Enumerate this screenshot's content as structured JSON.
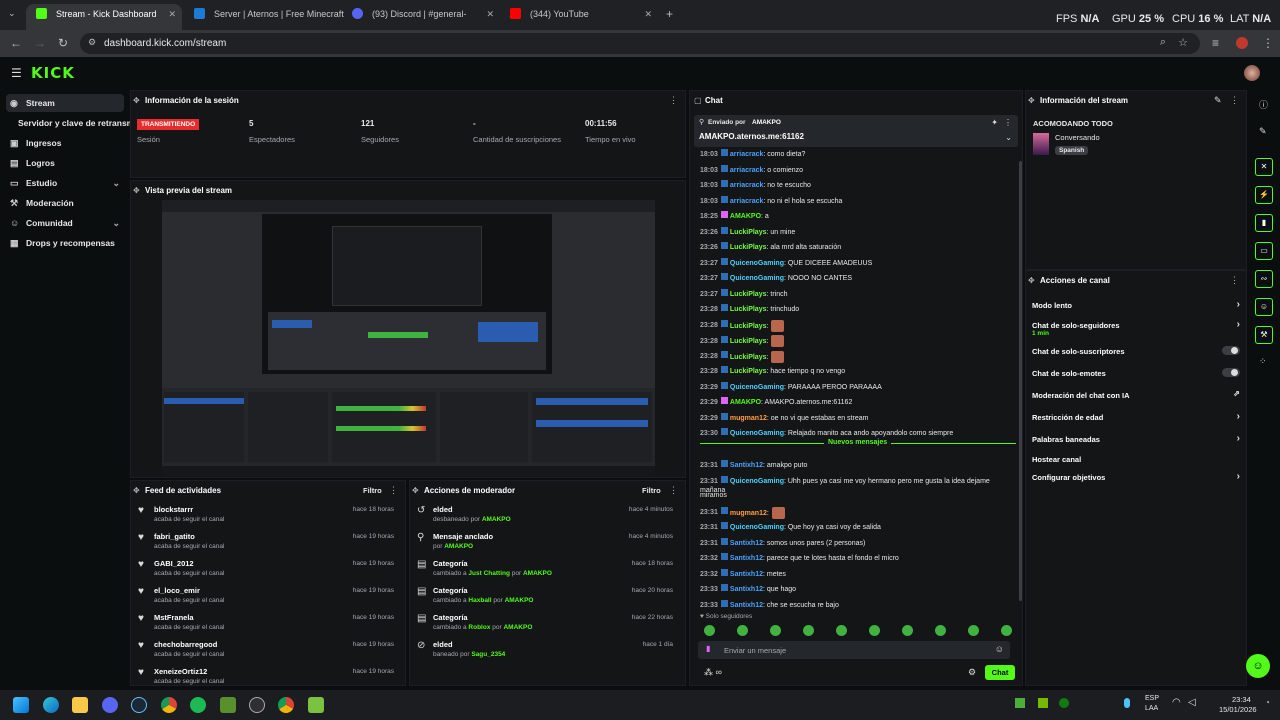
{
  "browser": {
    "tabs": [
      {
        "title": "Stream - Kick Dashboard",
        "color": "#53fc18"
      },
      {
        "title": "Server | Aternos | Free Minecraft",
        "color": "#1e7bd4"
      },
      {
        "title": "(93) Discord | #general-",
        "color": "#5865f2"
      },
      {
        "title": "(344) YouTube",
        "color": "#ff0000"
      }
    ],
    "url": "dashboard.kick.com/stream",
    "stats": {
      "fps_label": "FPS",
      "fps_value": "N/A",
      "gpu_label": "GPU",
      "gpu_value": "25 %",
      "cpu_label": "CPU",
      "cpu_value": "16 %",
      "lat_label": "LAT",
      "lat_value": "N/A"
    }
  },
  "header": {
    "logo": "KICK"
  },
  "sidebar": {
    "items": [
      {
        "label": "Stream",
        "icon": "broadcast-icon"
      },
      {
        "label": "Servidor y clave de retransmisión",
        "icon": ""
      },
      {
        "label": "Ingresos",
        "icon": "money-icon"
      },
      {
        "label": "Logros",
        "icon": "trophy-icon"
      },
      {
        "label": "Estudio",
        "icon": "studio-icon"
      },
      {
        "label": "Moderación",
        "icon": "shield-icon"
      },
      {
        "label": "Comunidad",
        "icon": "community-icon"
      },
      {
        "label": "Drops y recompensas",
        "icon": "gift-icon"
      }
    ]
  },
  "session": {
    "title": "Información de la sesión",
    "badge": "TRANSMITIENDO",
    "session_label": "Sesión",
    "viewers_value": "5",
    "viewers_label": "Espectadores",
    "followers_value": "121",
    "followers_label": "Seguidores",
    "subs_value": "-",
    "subs_label": "Cantidad de suscripciones",
    "time_value": "00:11:56",
    "time_label": "Tiempo en vivo"
  },
  "preview": {
    "title": "Vista previa del stream"
  },
  "feed": {
    "title": "Feed de actividades",
    "filter": "Filtro",
    "items": [
      {
        "name": "blockstarrr",
        "sub": "acaba de seguir el canal",
        "time": "hace 18 horas"
      },
      {
        "name": "fabri_gatito",
        "sub": "acaba de seguir el canal",
        "time": "hace 19 horas"
      },
      {
        "name": "GABI_2012",
        "sub": "acaba de seguir el canal",
        "time": "hace 19 horas"
      },
      {
        "name": "el_loco_emir",
        "sub": "acaba de seguir el canal",
        "time": "hace 19 horas"
      },
      {
        "name": "MstFranela",
        "sub": "acaba de seguir el canal",
        "time": "hace 19 horas"
      },
      {
        "name": "chechobarregood",
        "sub": "acaba de seguir el canal",
        "time": "hace 19 horas"
      },
      {
        "name": "XeneizeOrtiz12",
        "sub": "acaba de seguir el canal",
        "time": "hace 19 horas"
      }
    ]
  },
  "modactions": {
    "title": "Acciones de moderador",
    "filter": "Filtro",
    "items": [
      {
        "name": "elded",
        "pre": "desbaneado por",
        "mid": "",
        "mid2": "",
        "user": "AMAKPO",
        "time": "hace 4 minutos",
        "icon": "undo-icon"
      },
      {
        "name": "Mensaje anclado",
        "pre": "por",
        "mid": "",
        "mid2": "",
        "user": "AMAKPO",
        "time": "hace 4 minutos",
        "icon": "pin-icon"
      },
      {
        "name": "Categoría",
        "pre": "cambiado a",
        "mid": "Just Chatting",
        "mid2": "por",
        "user": "AMAKPO",
        "time": "hace 18 horas",
        "icon": "category-icon"
      },
      {
        "name": "Categoría",
        "pre": "cambiado a",
        "mid": "Haxball",
        "mid2": "por",
        "user": "AMAKPO",
        "time": "hace 20 horas",
        "icon": "category-icon"
      },
      {
        "name": "Categoría",
        "pre": "cambiado a",
        "mid": "Roblox",
        "mid2": "por",
        "user": "AMAKPO",
        "time": "hace 22 horas",
        "icon": "category-icon"
      },
      {
        "name": "elded",
        "pre": "baneado por",
        "mid": "",
        "mid2": "",
        "user": "Sagu_2354",
        "time": "hace 1 día",
        "icon": "ban-icon"
      }
    ]
  },
  "chat": {
    "title": "Chat",
    "pinned_by": "Enviado por",
    "pinned_user": "AMAKPO",
    "pinned_text": "AMAKPO.aternos.me:61162",
    "messages": [
      {
        "t": "18:03",
        "u": "arriacrack",
        "m": ": como dieta?",
        "c": "#4aa3ff"
      },
      {
        "t": "18:03",
        "u": "arriacrack",
        "m": ": o comienzo",
        "c": "#4aa3ff"
      },
      {
        "t": "18:03",
        "u": "arriacrack",
        "m": ": no te escucho",
        "c": "#4aa3ff"
      },
      {
        "t": "18:03",
        "u": "arriacrack",
        "m": ": no ni el hola se escucha",
        "c": "#4aa3ff"
      },
      {
        "t": "18:25",
        "u": "AMAKPO",
        "m": ": a",
        "c": "#53fc18"
      },
      {
        "t": "23:26",
        "u": "LuckiPlays",
        "m": ": un mine",
        "c": "#75fd46"
      },
      {
        "t": "23:26",
        "u": "LuckiPlays",
        "m": ": ala mrd alta saturación",
        "c": "#75fd46"
      },
      {
        "t": "23:27",
        "u": "QuicenoGaming",
        "m": ": QUE DICEEE AMADEUUS",
        "c": "#4fd1ff"
      },
      {
        "t": "23:27",
        "u": "QuicenoGaming",
        "m": ": NOOO NO CANTES",
        "c": "#4fd1ff"
      },
      {
        "t": "23:27",
        "u": "LuckiPlays",
        "m": ": trinch",
        "c": "#75fd46"
      },
      {
        "t": "23:28",
        "u": "LuckiPlays",
        "m": ": trinchudo",
        "c": "#75fd46"
      },
      {
        "t": "23:28",
        "u": "LuckiPlays",
        "m": ":",
        "c": "#75fd46",
        "emoji": true
      },
      {
        "t": "23:28",
        "u": "LuckiPlays",
        "m": ":",
        "c": "#75fd46",
        "emoji": true
      },
      {
        "t": "23:28",
        "u": "LuckiPlays",
        "m": ":",
        "c": "#75fd46",
        "emoji": true
      },
      {
        "t": "23:28",
        "u": "LuckiPlays",
        "m": ": hace tiempo q no vengo",
        "c": "#75fd46"
      },
      {
        "t": "23:29",
        "u": "QuicenoGaming",
        "m": ": PARAAAA PEROO PARAAAA",
        "c": "#4fd1ff"
      },
      {
        "t": "23:29",
        "u": "AMAKPO",
        "m": ": AMAKPO.aternos.me:61162",
        "c": "#53fc18"
      },
      {
        "t": "23:29",
        "u": "mugman12",
        "m": ": oe no vi que estabas en stream",
        "c": "#ff9f43"
      },
      {
        "t": "23:30",
        "u": "QuicenoGaming",
        "m": ": Relajado manito aca ando apoyandolo como siempre",
        "c": "#4fd1ff"
      }
    ],
    "new_label": "Nuevos mensajes",
    "new_messages": [
      {
        "t": "23:31",
        "u": "Santixh12",
        "m": ": amakpo puto",
        "c": "#4aa3ff"
      },
      {
        "t": "23:31",
        "u": "QuicenoGaming",
        "m": ": Uhh pues ya casi me voy hermano pero me gusta la idea dejame mañana",
        "c": "#4fd1ff"
      },
      {
        "t": "",
        "u": "",
        "m": "miramos",
        "c": "#fff"
      },
      {
        "t": "23:31",
        "u": "mugman12",
        "m": ":",
        "c": "#ff9f43",
        "emoji": true
      },
      {
        "t": "23:31",
        "u": "QuicenoGaming",
        "m": ": Que hoy ya casi voy de salida",
        "c": "#4fd1ff"
      },
      {
        "t": "23:31",
        "u": "Santixh12",
        "m": ": somos unos pares (2 personas)",
        "c": "#4aa3ff"
      },
      {
        "t": "23:32",
        "u": "Santixh12",
        "m": ": parece que te lotes hasta el fondo el micro",
        "c": "#4aa3ff"
      },
      {
        "t": "23:32",
        "u": "Santixh12",
        "m": ": metes",
        "c": "#4aa3ff"
      },
      {
        "t": "23:33",
        "u": "Santixh12",
        "m": ": que hago",
        "c": "#4aa3ff"
      },
      {
        "t": "23:33",
        "u": "Santixh12",
        "m": ": che se escucha re bajo",
        "c": "#4aa3ff"
      }
    ],
    "followers_only": "Solo seguidores",
    "input_placeholder": "Enviar un mensaje",
    "send_label": "Chat"
  },
  "streaminfo": {
    "title": "Información del stream",
    "stream_title": "ACOMODANDO TODO",
    "category": "Conversando",
    "language": "Spanish"
  },
  "channelactions": {
    "title": "Acciones de canal",
    "items": [
      {
        "label": "Modo lento",
        "sub": "",
        "kind": "arrow"
      },
      {
        "label": "Chat de solo-seguidores",
        "sub": "1 min",
        "kind": "arrow"
      },
      {
        "label": "Chat de solo-suscriptores",
        "sub": "",
        "kind": "toggle"
      },
      {
        "label": "Chat de solo-emotes",
        "sub": "",
        "kind": "toggle"
      },
      {
        "label": "Moderación del chat con IA",
        "sub": "",
        "kind": "external"
      },
      {
        "label": "Restricción de edad",
        "sub": "",
        "kind": "arrow"
      },
      {
        "label": "Palabras baneadas",
        "sub": "",
        "kind": "arrow"
      },
      {
        "label": "Hostear canal",
        "sub": "",
        "kind": "none"
      },
      {
        "label": "Configurar objetivos",
        "sub": "",
        "kind": "arrow"
      }
    ]
  },
  "taskbar": {
    "lang": "ESP",
    "lang2": "LAA",
    "time": "23:34",
    "date": "15/01/2026"
  }
}
